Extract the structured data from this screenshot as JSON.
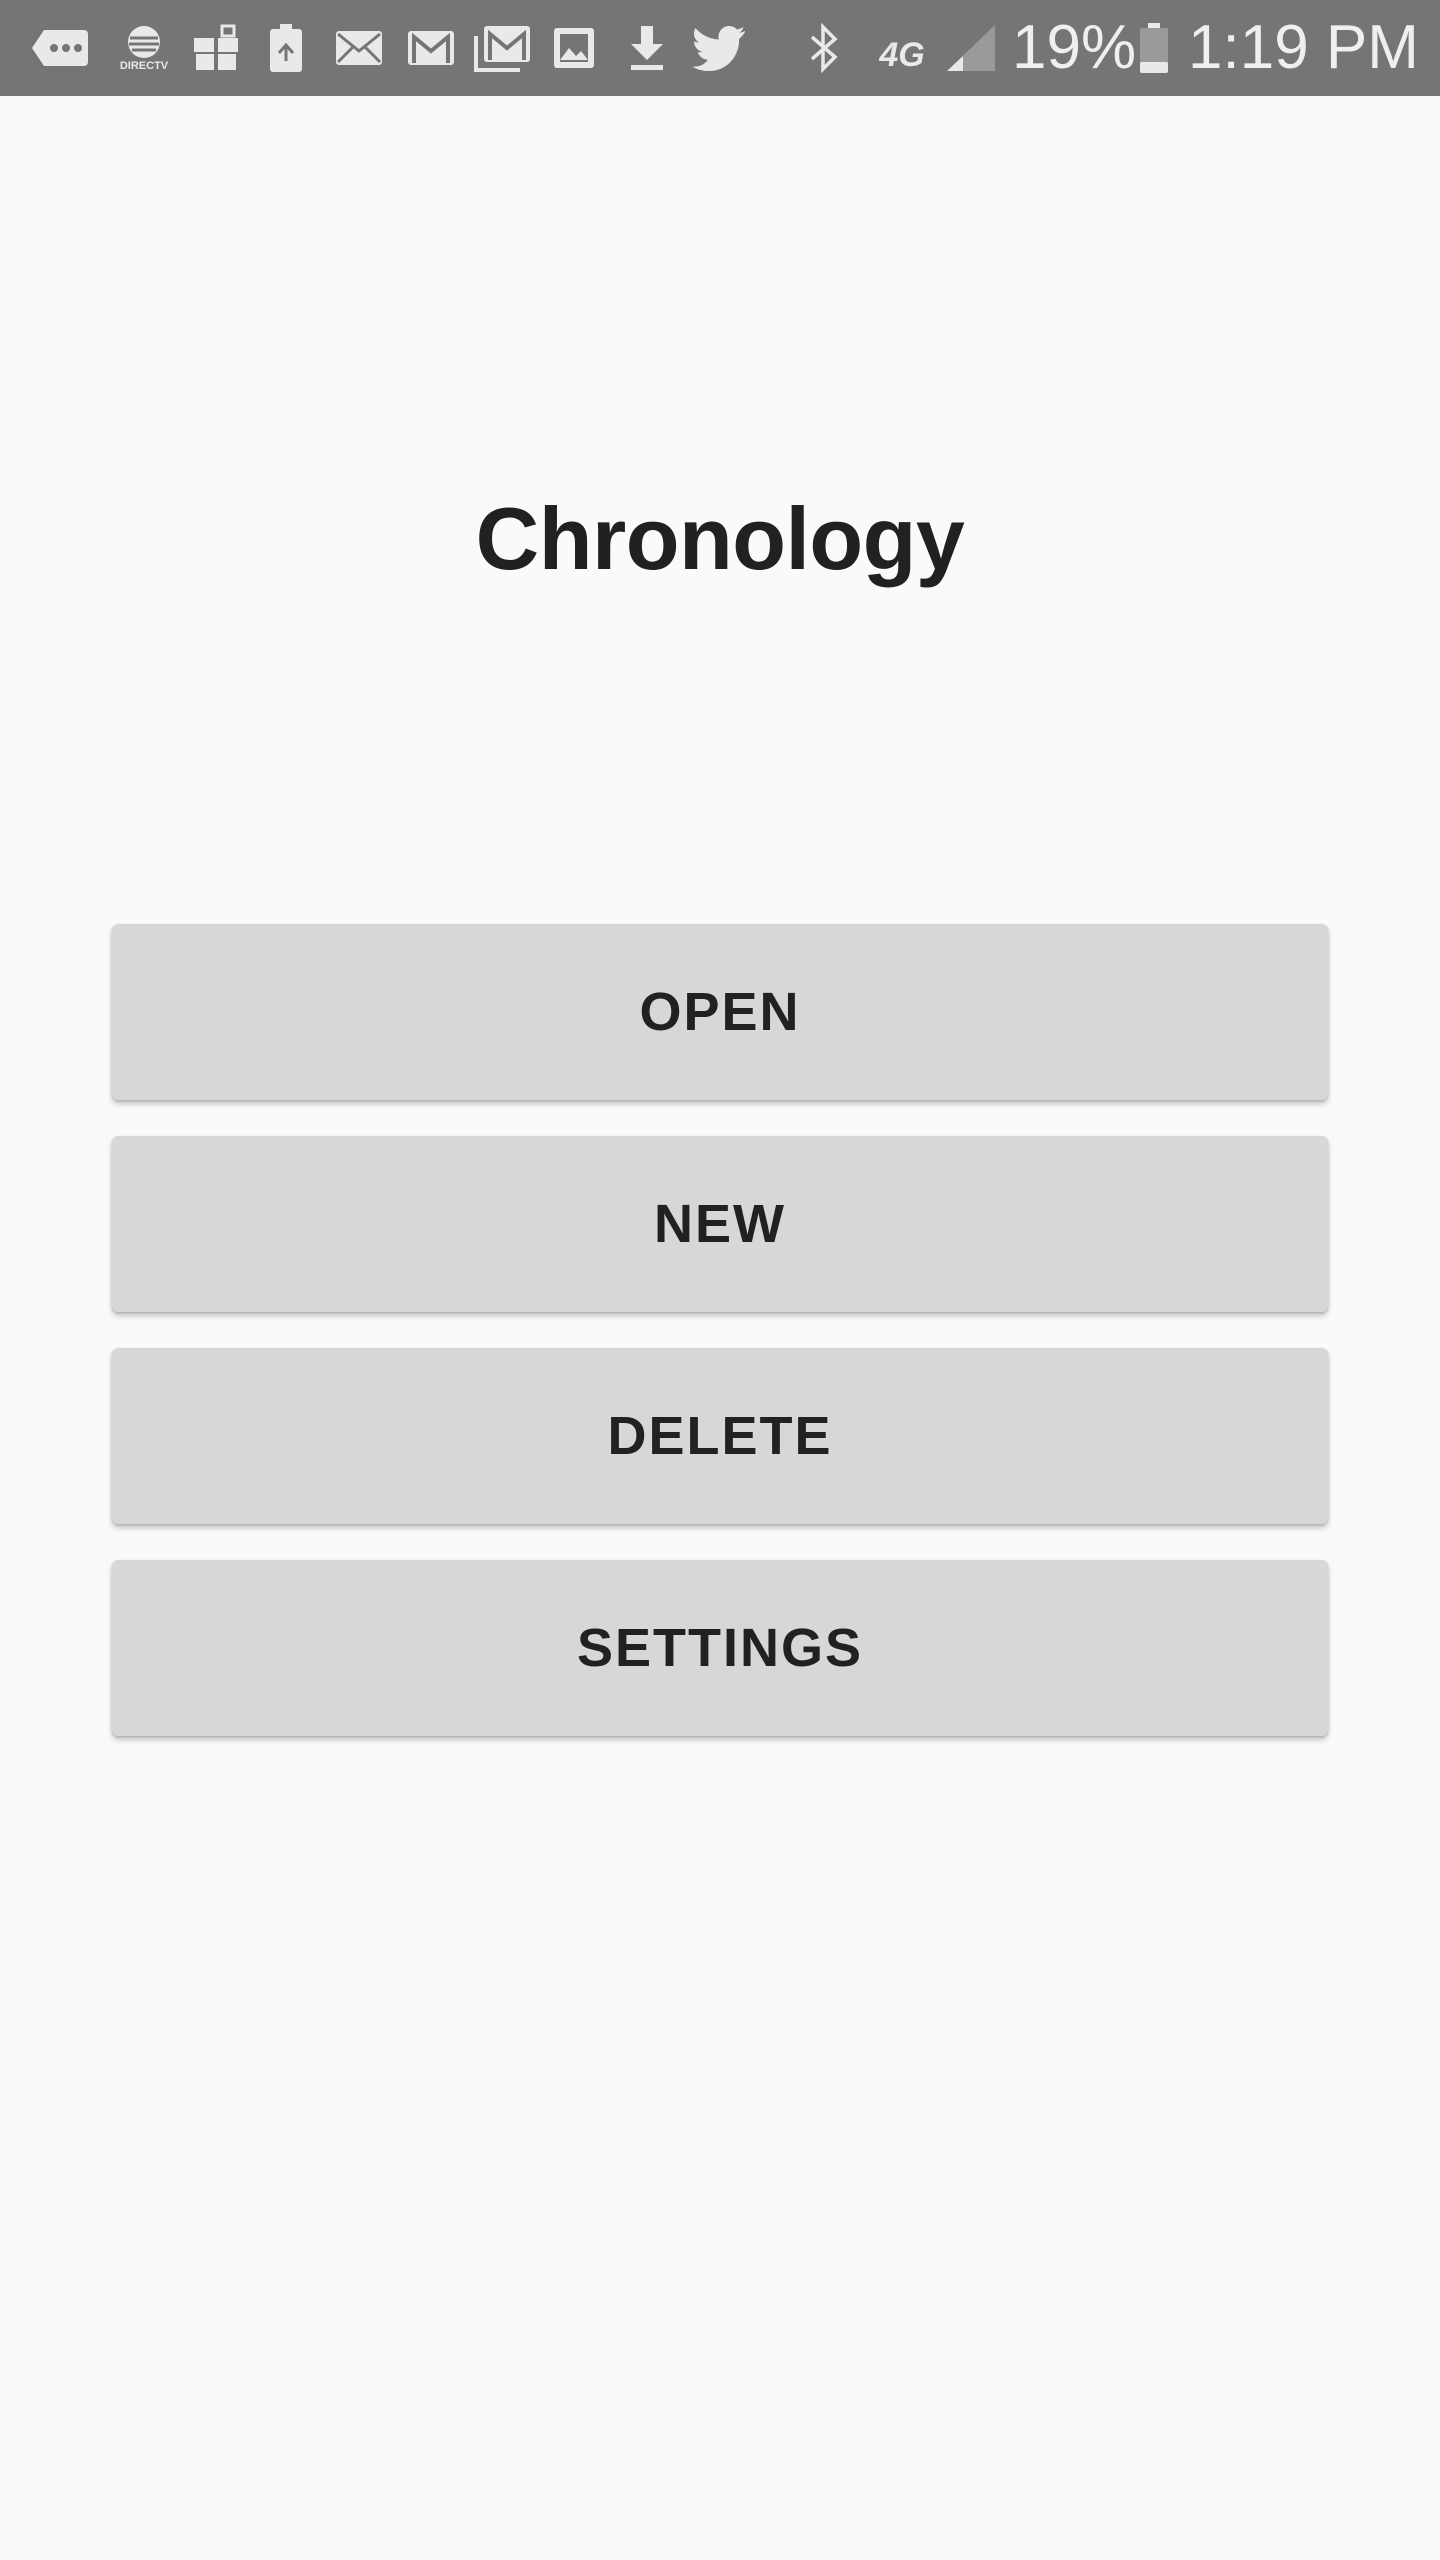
{
  "status_bar": {
    "battery_percent": "19%",
    "time": "1:19 PM",
    "network_type": "4G",
    "carrier_label": "DIRECTV",
    "icons": [
      "message-icon",
      "att-directv-icon",
      "gift-icon",
      "battery-recycle-icon",
      "mail-icon",
      "gmail-icon",
      "gmail-multiple-icon",
      "image-icon",
      "download-icon",
      "twitter-icon",
      "bluetooth-icon",
      "lte-4g-icon",
      "signal-icon",
      "battery-icon"
    ],
    "colors": {
      "background": "#757575",
      "foreground": "#e9e9e9"
    }
  },
  "app": {
    "title": "Chronology"
  },
  "menu": {
    "open_label": "OPEN",
    "new_label": "NEW",
    "delete_label": "DELETE",
    "settings_label": "SETTINGS"
  },
  "colors": {
    "background": "#fafafa",
    "button": "#d6d7d7",
    "text": "#212121"
  }
}
